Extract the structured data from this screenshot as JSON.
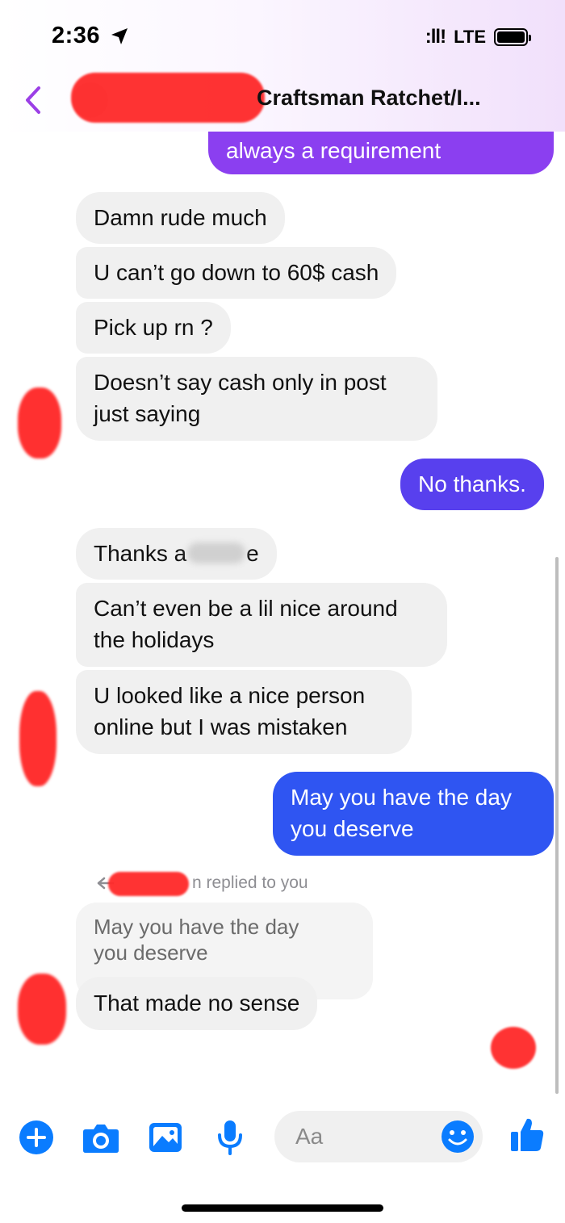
{
  "status_bar": {
    "time": "2:36",
    "signal": ":ll!",
    "network": "LTE"
  },
  "header": {
    "title": "Craftsman Ratchet/I..."
  },
  "messages": {
    "m0": "always a requirement",
    "m1": "Damn rude much",
    "m2": "U can’t go down to 60$ cash",
    "m3": "Pick up rn ?",
    "m4a": "Doesn’t say cash only in post",
    "m4b": "just saying",
    "m5": "No thanks.",
    "m6a": "Thanks a",
    "m6b": "e",
    "m7a": "Can’t even be a lil nice around",
    "m7b": "the holidays",
    "m8a": "U looked like a nice person",
    "m8b": "online but I was mistaken",
    "m9a": "May you have the day",
    "m9b": "you deserve",
    "m10": "That made no sense"
  },
  "reply": {
    "label": "n replied to you",
    "quoted_line1": "May you have the day",
    "quoted_line2": "you deserve"
  },
  "composer": {
    "placeholder": "Aa"
  },
  "colors": {
    "accent": "#0a7cff",
    "outgoing_purple": "#8b3ff0",
    "outgoing_indigo": "#5840ee",
    "outgoing_blue": "#2f55f2",
    "incoming": "#f0f0f0",
    "back_chevron": "#9b3fe6"
  },
  "icons": [
    "location-arrow-icon",
    "battery-icon",
    "back-chevron-icon",
    "plus-icon",
    "camera-icon",
    "image-icon",
    "microphone-icon",
    "emoji-icon",
    "thumbs-up-icon",
    "reply-arrow-icon"
  ]
}
